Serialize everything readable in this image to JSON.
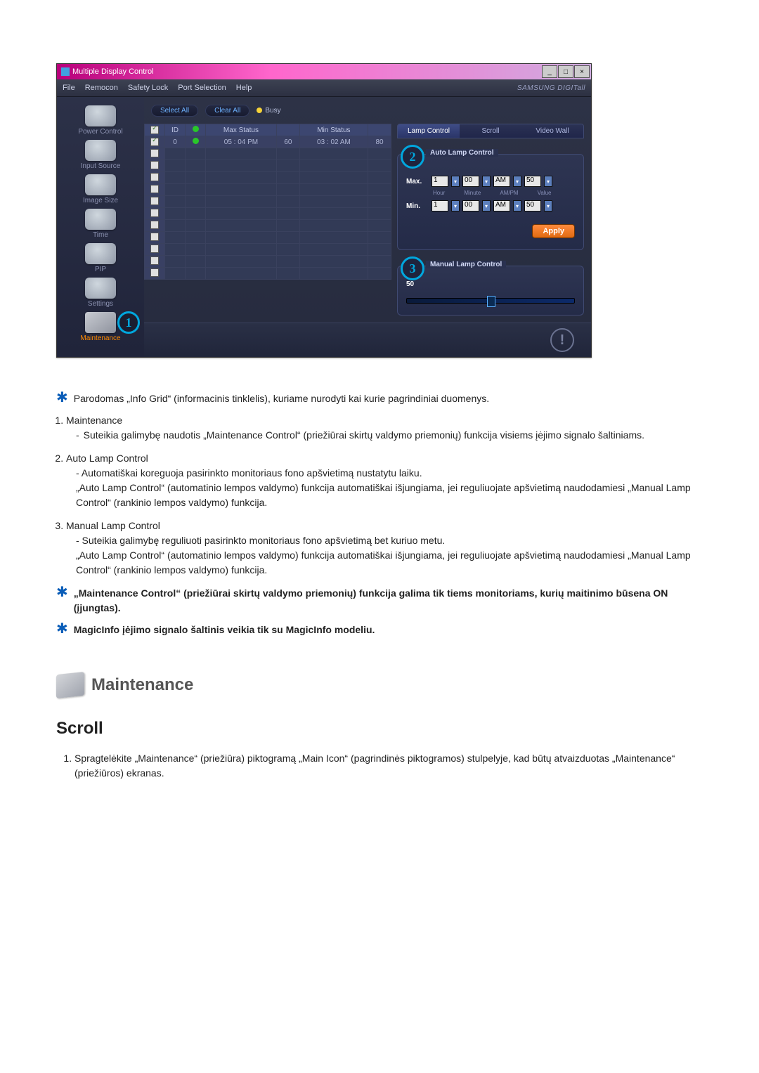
{
  "app": {
    "window_title": "Multiple Display Control",
    "samsung_brand": "SAMSUNG DIGITall",
    "menus": [
      "File",
      "Remocon",
      "Safety Lock",
      "Port Selection",
      "Help"
    ],
    "buttons": {
      "select_all": "Select All",
      "clear_all": "Clear All",
      "busy": "Busy",
      "apply": "Apply"
    },
    "sidebar": [
      {
        "label": "Power Control"
      },
      {
        "label": "Input Source"
      },
      {
        "label": "Image Size"
      },
      {
        "label": "Time"
      },
      {
        "label": "PIP"
      },
      {
        "label": "Settings"
      },
      {
        "label": "Maintenance"
      }
    ],
    "grid": {
      "headers": {
        "chk": "",
        "id": "ID",
        "stat": "",
        "max": "Max Status",
        "max_b": "",
        "min": "Min Status",
        "min_b": ""
      },
      "row0": {
        "id": "0",
        "max_time": "05 : 04 PM",
        "max_v": "60",
        "min_time": "03 : 02 AM",
        "min_v": "80"
      },
      "empty_rows": 11
    },
    "right_tabs": [
      "Lamp Control",
      "Scroll",
      "Video Wall"
    ],
    "auto_lamp": {
      "legend": "Auto Lamp Control",
      "max_label": "Max.",
      "min_label": "Min.",
      "cols": [
        "Hour",
        "Minute",
        "AM/PM",
        "Value"
      ],
      "max": {
        "hour": "1",
        "min": "00",
        "ampm": "AM",
        "val": "50"
      },
      "min": {
        "hour": "1",
        "min": "00",
        "ampm": "AM",
        "val": "50"
      }
    },
    "manual_lamp": {
      "legend": "Manual Lamp Control",
      "value": "50"
    }
  },
  "doc": {
    "intro": "Parodomas „Info Grid“ (informacinis tinklelis), kuriame nurodyti kai kurie pagrindiniai duomenys.",
    "items": {
      "i1t": "Maintenance",
      "i1b": "Suteikia galimybę naudotis „Maintenance Control“ (priežiūrai skirtų valdymo priemonių) funkcija visiems įėjimo signalo šaltiniams.",
      "i2t": "Auto Lamp Control",
      "i2a": "- Automatiškai koreguoja pasirinkto monitoriaus fono apšvietimą nustatytu laiku.",
      "i2b": "„Auto Lamp Control“ (automatinio lempos valdymo) funkcija automatiškai išjungiama, jei reguliuojate apšvietimą naudodamiesi „Manual Lamp Control“ (rankinio lempos valdymo) funkcija.",
      "i3t": "Manual Lamp Control",
      "i3a": "- Suteikia galimybę reguliuoti pasirinkto monitoriaus fono apšvietimą bet kuriuo metu.",
      "i3b": "„Auto Lamp Control“ (automatinio lempos valdymo) funkcija automatiškai išjungiama, jei reguliuojate apšvietimą naudodamiesi „Manual Lamp Control“ (rankinio lempos valdymo) funkcija."
    },
    "star2": "„Maintenance Control“ (priežiūrai skirtų valdymo priemonių) funkcija galima tik tiems monitoriams, kurių maitinimo būsena ON (įjungtas).",
    "star3": "MagicInfo įėjimo signalo šaltinis veikia tik su MagicInfo modeliu.",
    "section_title": "Maintenance",
    "subhead": "Scroll",
    "step1": "Spragtelėkite „Maintenance“ (priežiūra) piktogramą „Main Icon“ (pagrindinės piktogramos) stulpelyje, kad būtų atvaizduotas „Maintenance“ (priežiūros) ekranas."
  }
}
